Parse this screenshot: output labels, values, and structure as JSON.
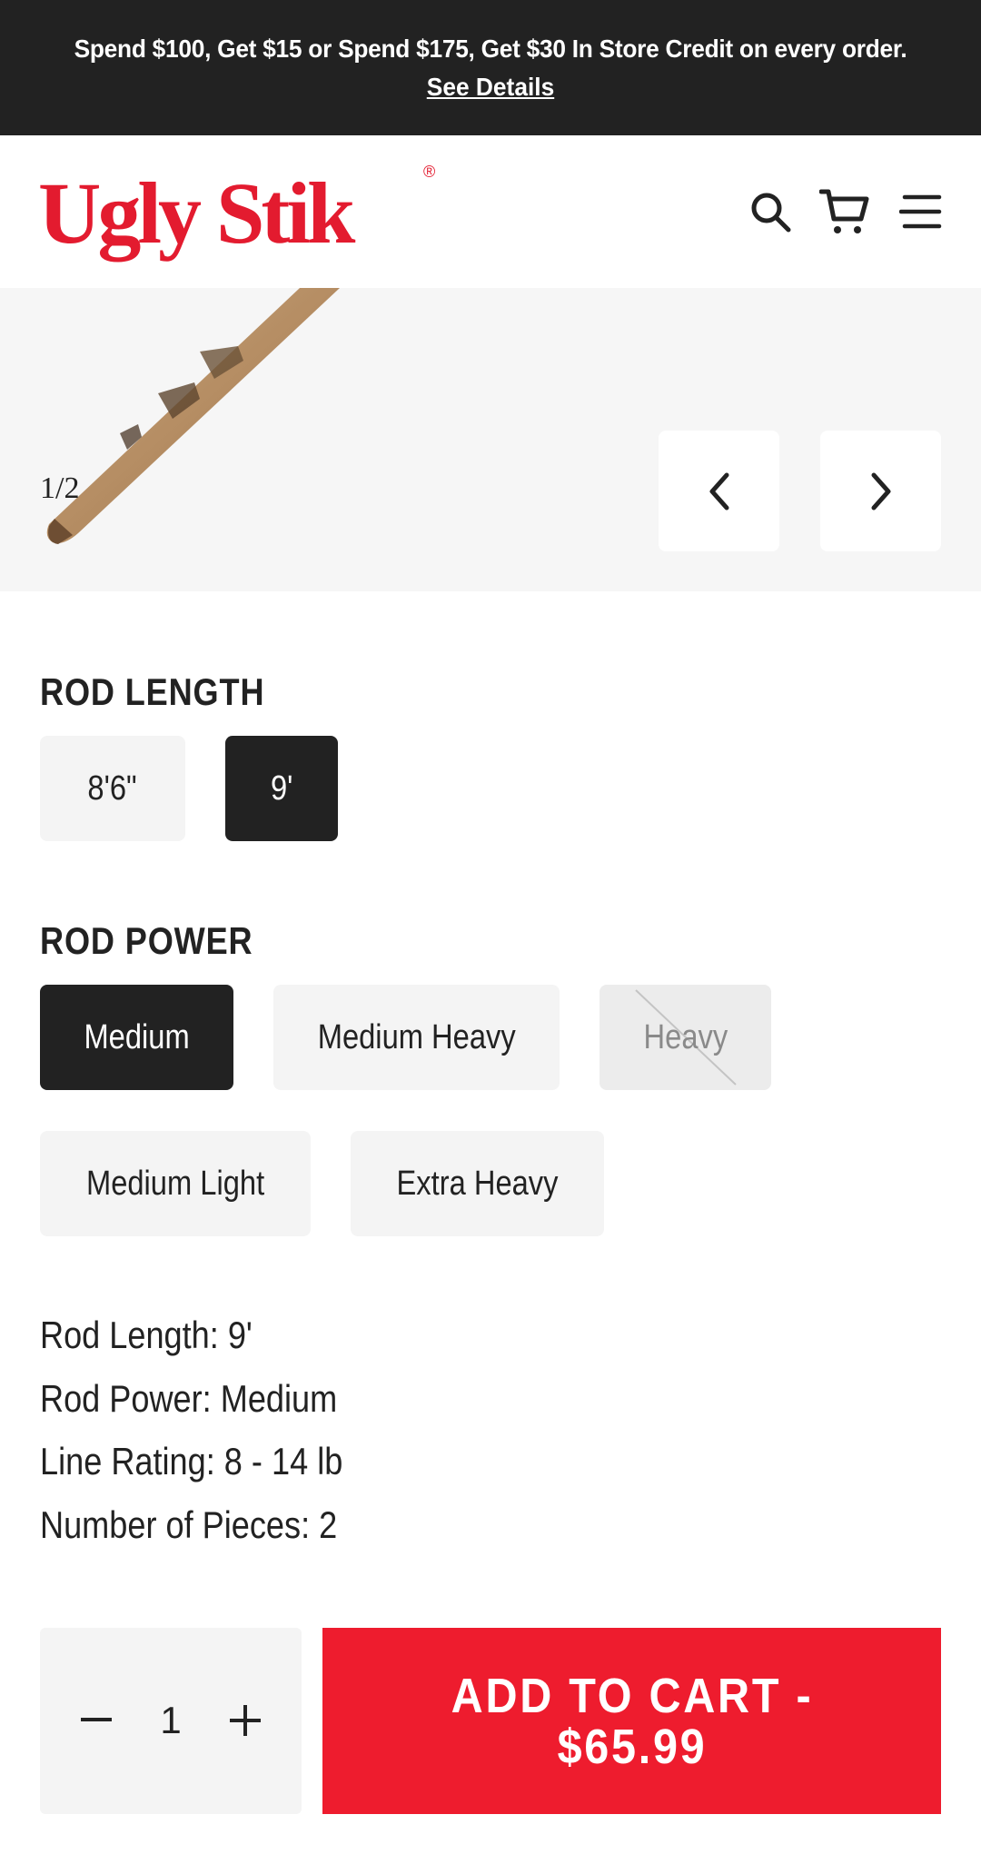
{
  "promo": {
    "text": "Spend $100, Get $15 or Spend $175, Get $30 In Store Credit on every order.",
    "link": "See Details"
  },
  "header": {
    "logo_text": "Ugly Stik",
    "logo_mark": "®",
    "icons": [
      "search-icon",
      "cart-icon",
      "menu-icon"
    ]
  },
  "gallery": {
    "counter": "1/2",
    "prev_icon": "chevron-left-icon",
    "next_icon": "chevron-right-icon"
  },
  "rod_length": {
    "title": "ROD LENGTH",
    "options": [
      {
        "label": "8'6\"",
        "state": "default"
      },
      {
        "label": "9'",
        "state": "selected"
      }
    ]
  },
  "rod_power": {
    "title": "ROD POWER",
    "options": [
      {
        "label": "Medium",
        "state": "selected"
      },
      {
        "label": "Medium Heavy",
        "state": "default"
      },
      {
        "label": "Heavy",
        "state": "disabled"
      },
      {
        "label": "Medium Light",
        "state": "default"
      },
      {
        "label": "Extra Heavy",
        "state": "default"
      }
    ]
  },
  "specs": [
    "Rod Length: 9'",
    "Rod Power: Medium",
    "Line Rating: 8 - 14 lb",
    "Number of Pieces: 2"
  ],
  "purchase": {
    "quantity": "1",
    "add_to_cart": "ADD TO CART - $65.99"
  },
  "colors": {
    "brand_red": "#e31b2f",
    "cart_red": "#ee1c2e",
    "dark": "#222222",
    "option_bg": "#f4f4f4",
    "gallery_bg": "#f6f6f6"
  }
}
